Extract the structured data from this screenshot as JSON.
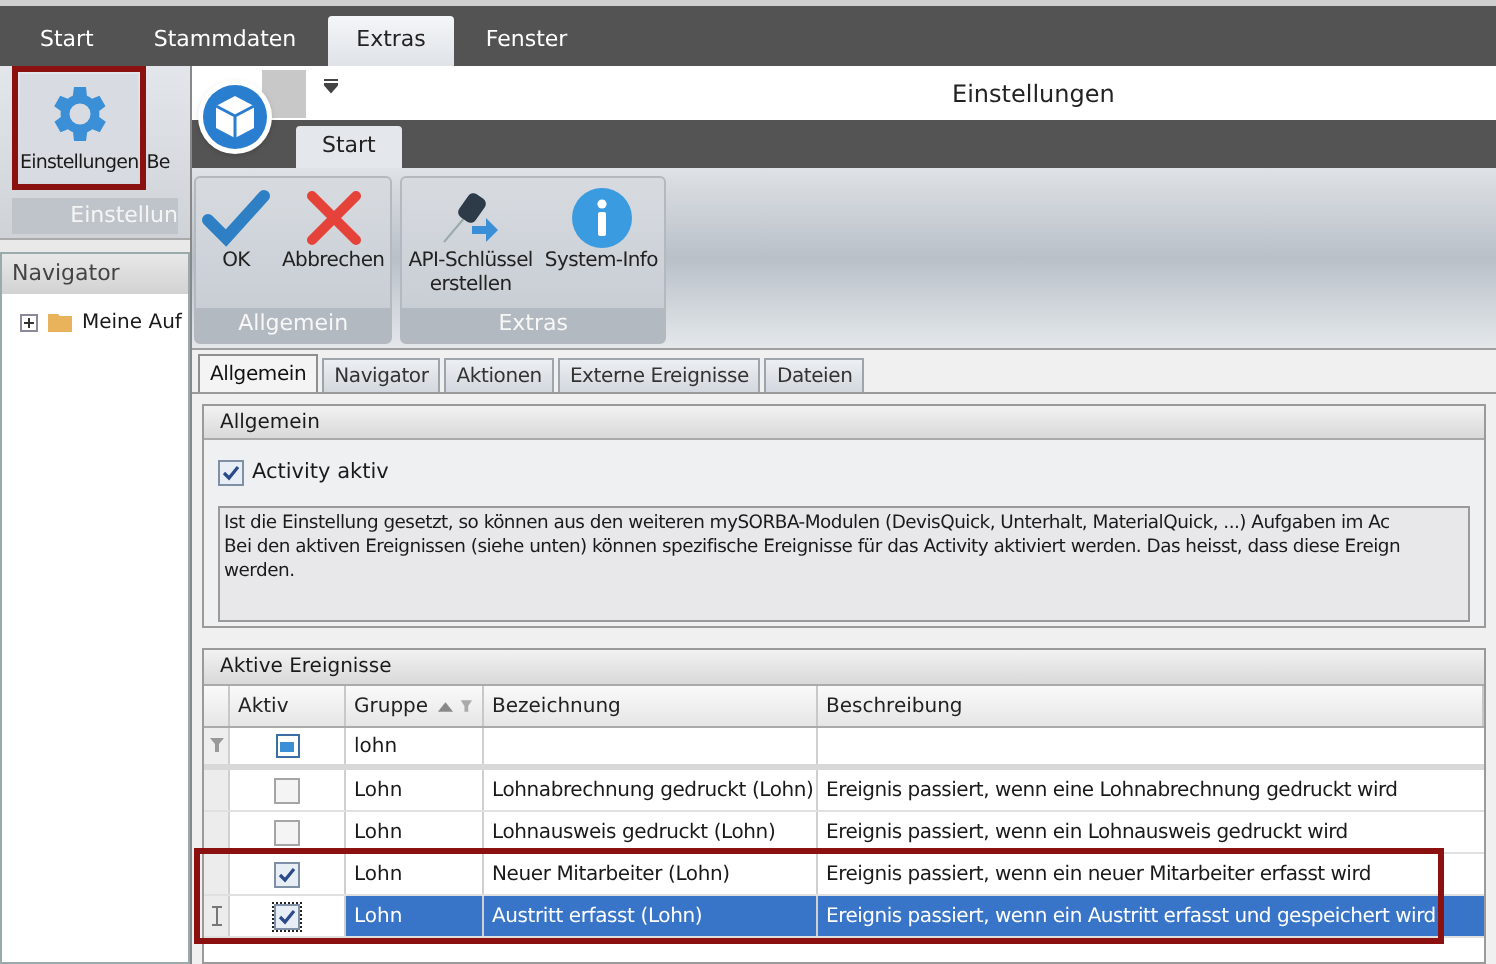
{
  "app": {
    "menu_tabs": [
      {
        "label": "Start",
        "selected": false
      },
      {
        "label": "Stammdaten",
        "selected": false
      },
      {
        "label": "Extras",
        "selected": true
      },
      {
        "label": "Fenster",
        "selected": false
      }
    ],
    "ribbon": {
      "buttons": [
        {
          "label": "Einstellungen",
          "highlighted": true
        },
        {
          "label": "Be",
          "highlighted": false
        }
      ],
      "group_label": "Einstellun"
    },
    "navigator": {
      "title": "Navigator",
      "items": [
        {
          "label": "Meine Auf",
          "expanded": false
        }
      ]
    }
  },
  "dialog": {
    "title": "Einstellungen",
    "ribbon_tabs": [
      {
        "label": "Start",
        "selected": true
      }
    ],
    "groups": [
      {
        "label": "Allgemein",
        "buttons": [
          {
            "label": "OK"
          },
          {
            "label": "Abbrechen"
          }
        ]
      },
      {
        "label": "Extras",
        "buttons": [
          {
            "label": "API-Schlüssel erstellen"
          },
          {
            "label": "System-Info"
          }
        ]
      }
    ],
    "tabs": [
      {
        "label": "Allgemein",
        "selected": true
      },
      {
        "label": "Navigator",
        "selected": false
      },
      {
        "label": "Aktionen",
        "selected": false
      },
      {
        "label": "Externe Ereignisse",
        "selected": false
      },
      {
        "label": "Dateien",
        "selected": false
      }
    ],
    "general": {
      "title": "Allgemein",
      "checkbox": {
        "label": "Activity aktiv",
        "checked": true
      },
      "description": [
        "Ist die Einstellung gesetzt, so können aus den weiteren mySORBA-Modulen (DevisQuick, Unterhalt, MaterialQuick, ...) Aufgaben im Ac",
        "Bei den aktiven Ereignissen (siehe unten) können spezifische Ereignisse für das Activity aktiviert werden. Das heisst, dass diese Ereign",
        "werden."
      ]
    },
    "events": {
      "title": "Aktive Ereignisse",
      "columns": [
        "Aktiv",
        "Gruppe",
        "Bezeichnung",
        "Beschreibung"
      ],
      "filter": {
        "group": "lohn",
        "active_indeterminate": true
      },
      "rows": [
        {
          "active": false,
          "group": "Lohn",
          "name": "Lohnabrechnung gedruckt (Lohn)",
          "description": "Ereignis passiert, wenn eine Lohnabrechnung gedruckt wird",
          "selected": false,
          "highlighted": false
        },
        {
          "active": false,
          "group": "Lohn",
          "name": "Lohnausweis gedruckt (Lohn)",
          "description": "Ereignis passiert, wenn ein Lohnausweis gedruckt wird",
          "selected": false,
          "highlighted": false
        },
        {
          "active": true,
          "group": "Lohn",
          "name": "Neuer Mitarbeiter (Lohn)",
          "description": "Ereignis passiert, wenn ein neuer Mitarbeiter erfasst wird",
          "selected": false,
          "highlighted": true
        },
        {
          "active": true,
          "group": "Lohn",
          "name": "Austritt erfasst (Lohn)",
          "description": "Ereignis passiert, wenn ein Austritt erfasst und gespeichert wird",
          "selected": true,
          "highlighted": true
        }
      ]
    }
  }
}
